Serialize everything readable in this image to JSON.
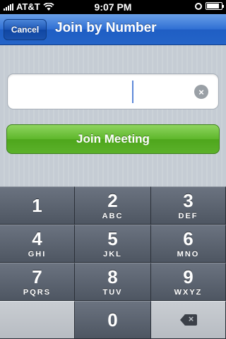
{
  "status_bar": {
    "carrier": "AT&T",
    "time": "9:07 PM",
    "battery_level": 0.85
  },
  "nav": {
    "cancel_label": "Cancel",
    "title": "Join by Number"
  },
  "form": {
    "meeting_number_value": "",
    "clear_icon": "×",
    "join_label": "Join Meeting"
  },
  "keypad": {
    "keys": [
      {
        "digit": "1",
        "letters": ""
      },
      {
        "digit": "2",
        "letters": "ABC"
      },
      {
        "digit": "3",
        "letters": "DEF"
      },
      {
        "digit": "4",
        "letters": "GHI"
      },
      {
        "digit": "5",
        "letters": "JKL"
      },
      {
        "digit": "6",
        "letters": "MNO"
      },
      {
        "digit": "7",
        "letters": "PQRS"
      },
      {
        "digit": "8",
        "letters": "TUV"
      },
      {
        "digit": "9",
        "letters": "WXYZ"
      },
      {
        "digit": "0",
        "letters": ""
      }
    ]
  },
  "colors": {
    "nav_blue": "#2f6fd3",
    "join_green": "#5eb72b",
    "keypad_gray": "#4e5662"
  }
}
